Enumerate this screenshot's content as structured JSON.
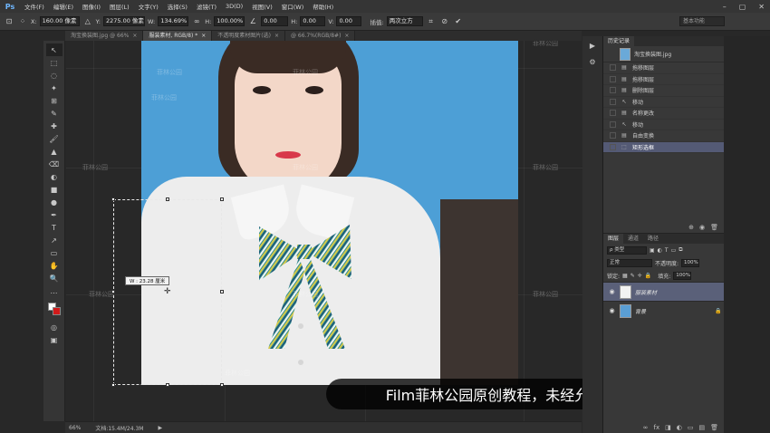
{
  "app": {
    "logo": "Ps"
  },
  "menu": [
    "文件(F)",
    "编辑(E)",
    "图像(I)",
    "图层(L)",
    "文字(Y)",
    "选择(S)",
    "滤镜(T)",
    "3D(D)",
    "视图(V)",
    "窗口(W)",
    "帮助(H)"
  ],
  "window_controls": [
    "–",
    "▢",
    "✕"
  ],
  "options": {
    "x_label": "X:",
    "x_value": "160.00 像素",
    "y_label": "Y:",
    "y_value": "2275.00 像素",
    "w_label": "W:",
    "w_value": "134.69%",
    "h_label": "H:",
    "h_value": "100.00%",
    "angle_value": "0.00",
    "hskew_label": "H:",
    "hskew_value": "0.00",
    "vskew_label": "V:",
    "vskew_value": "0.00",
    "interp_label": "插值:",
    "interp_value": "两次立方",
    "workspace": "基本功能"
  },
  "tabs": [
    {
      "label": "淘宝换装图.jpg @ 66%",
      "close": "×"
    },
    {
      "label": "服装素材, RGB/8) *",
      "close": "×"
    },
    {
      "label": "不透明度素材图片(选)",
      "close": "×"
    },
    {
      "label": "@ 66.7%(RGB/8#)",
      "close": "×"
    }
  ],
  "tools": [
    "↖",
    "⬚",
    "◌",
    "✦",
    "⊞",
    "✎",
    "✚",
    "🖌",
    "▲",
    "⌫",
    "◐",
    "■",
    "●",
    "✒",
    "T",
    "↗",
    "▭",
    "✋",
    "🔍",
    "…"
  ],
  "canvas": {
    "watermarks": [
      "菲林公园",
      "菲林公园",
      "菲林公园",
      "菲林公园",
      "菲林公园",
      "菲林公园",
      "菲林公园",
      "菲林公园",
      "菲林公园",
      "菲林公园",
      "菲林公园"
    ],
    "width_tooltip": "W : 23.28 厘米"
  },
  "status": {
    "zoom": "66%",
    "doc": "文档:15.4M/24.3M",
    "arrow": "▶"
  },
  "subtitle": "Film菲林公园原创教程，未经允许不得转载",
  "history": {
    "tabs": [
      "历史记录"
    ],
    "snapshot": "淘宝换装图.jpg",
    "items": [
      {
        "label": "拖移图层",
        "icon": "▤",
        "active": false
      },
      {
        "label": "拖移图层",
        "icon": "▤",
        "active": false
      },
      {
        "label": "删除图层",
        "icon": "▤",
        "active": false
      },
      {
        "label": "移动",
        "icon": "↖",
        "active": false
      },
      {
        "label": "名称更改",
        "icon": "▤",
        "active": false
      },
      {
        "label": "移动",
        "icon": "↖",
        "active": false
      },
      {
        "label": "自由变换",
        "icon": "▤",
        "active": false
      },
      {
        "label": "矩形选框",
        "icon": "⬚",
        "active": true
      }
    ],
    "footer": [
      "⊕",
      "◉",
      "🗑"
    ]
  },
  "layers": {
    "tabs": [
      "图层",
      "通道",
      "路径"
    ],
    "filter_label": "ρ 类型",
    "blend_mode": "正常",
    "opacity_label": "不透明度:",
    "opacity_value": "100%",
    "lock_label": "锁定:",
    "fill_label": "填充:",
    "fill_value": "100%",
    "items": [
      {
        "name": "服装素材",
        "active": true,
        "lock": "",
        "thumb": "#f2f2f2"
      },
      {
        "name": "背景",
        "active": false,
        "lock": "🔒",
        "thumb": "#5a9ed4"
      }
    ],
    "footer": [
      "∞",
      "fx",
      "◨",
      "◐",
      "▭",
      "▤",
      "🗑"
    ]
  },
  "panel_strip": [
    "▶",
    "⚙"
  ]
}
